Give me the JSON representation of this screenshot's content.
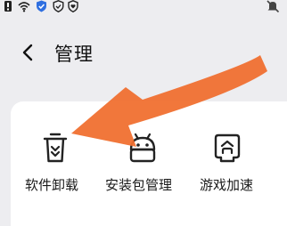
{
  "status_bar": {
    "icons": [
      "notification-icon",
      "wifi-icon",
      "shield-check-icon",
      "shield-icon",
      "shield-heart-icon",
      "mute-icon"
    ]
  },
  "header": {
    "back_icon": "chevron-left-icon",
    "title": "管理"
  },
  "tools": [
    {
      "label": "软件卸载",
      "icon": "trash-icon"
    },
    {
      "label": "安装包管理",
      "icon": "android-icon"
    },
    {
      "label": "游戏加速",
      "icon": "game-controller-icon"
    }
  ],
  "annotation": {
    "arrow_color": "#f07030"
  }
}
